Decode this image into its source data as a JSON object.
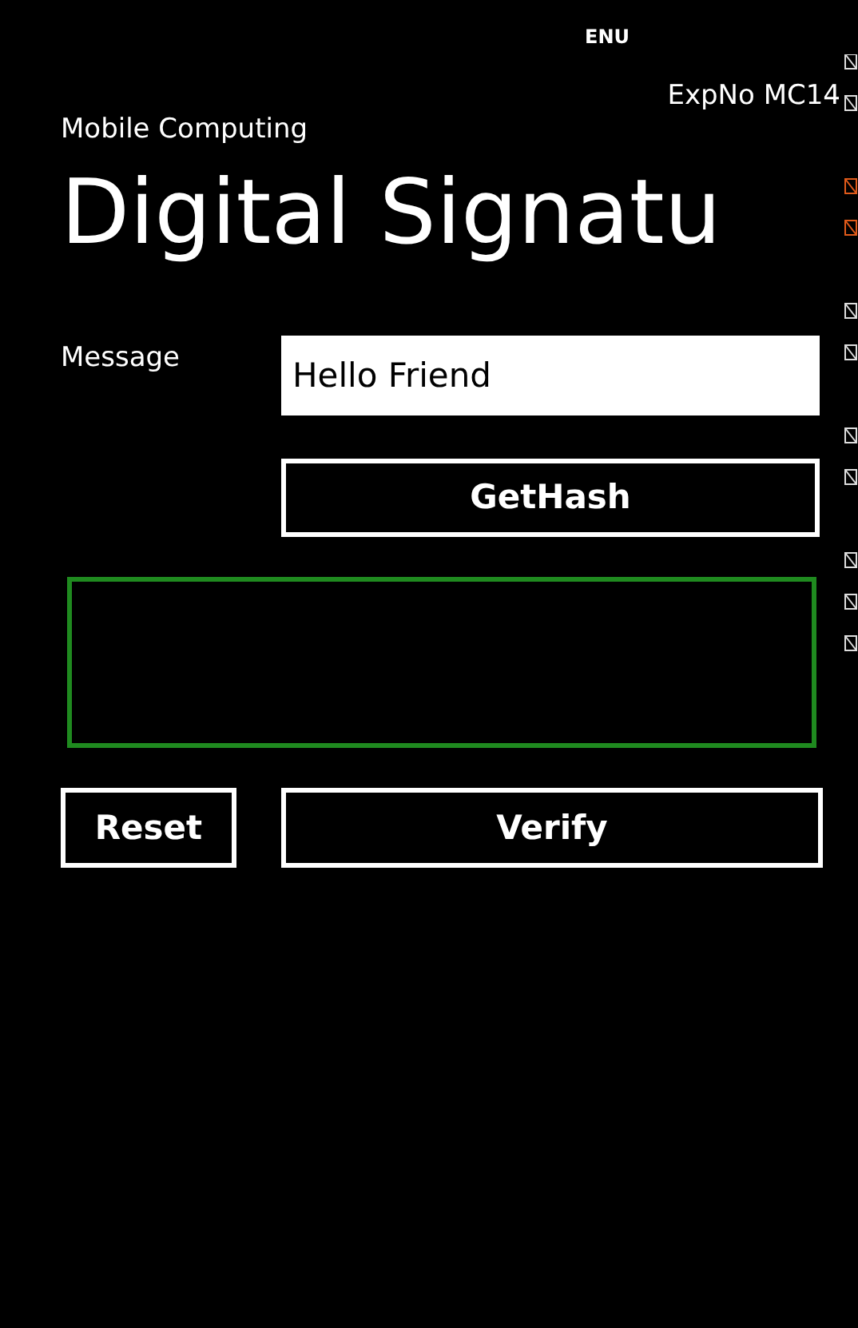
{
  "status_bar": {
    "language": "ENU"
  },
  "header": {
    "experiment": "ExpNo MC14",
    "app_title": "Mobile Computing",
    "page_title": "Digital Signatu"
  },
  "form": {
    "message_label": "Message",
    "message_value": "Hello Friend",
    "hash_button": "GetHash"
  },
  "actions": [
    {
      "label": "Reset",
      "kind": "small"
    },
    {
      "label": "Verify",
      "kind": "wide"
    }
  ]
}
